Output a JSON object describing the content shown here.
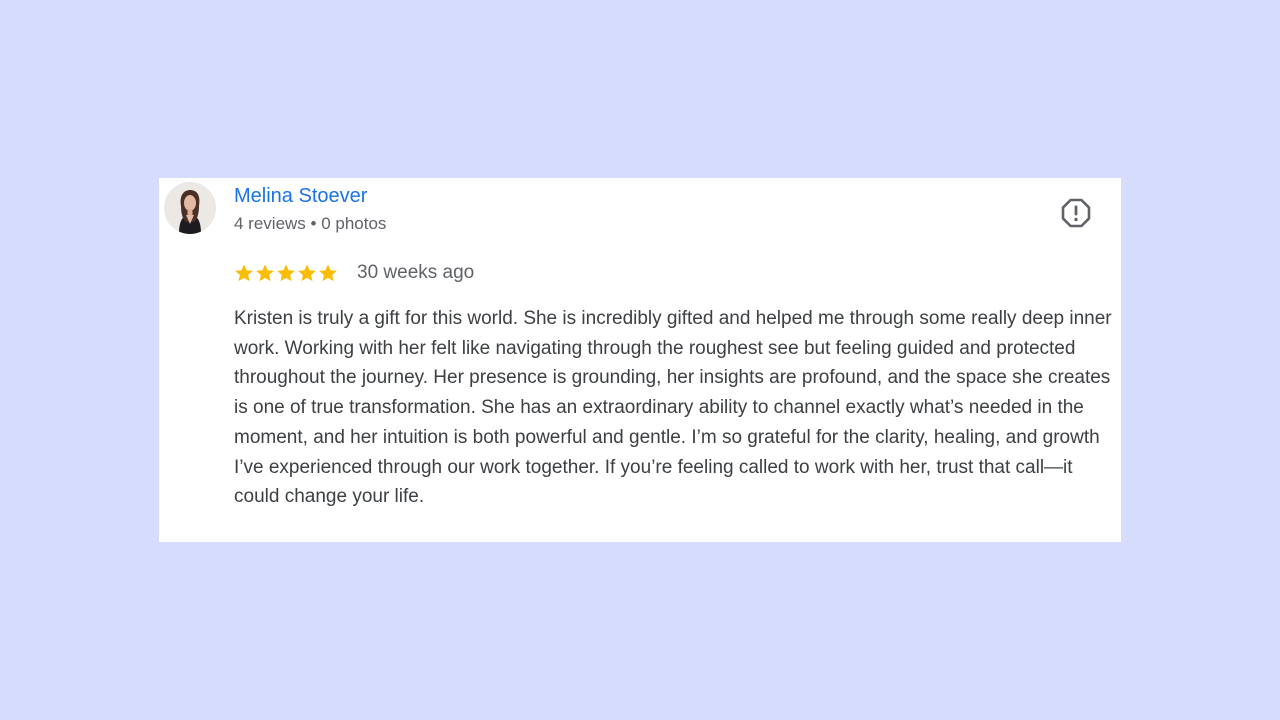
{
  "review": {
    "reviewer": {
      "name": "Melina Stoever",
      "stats": "4 reviews • 0 photos",
      "avatar_icon": "person-photo"
    },
    "rating": 5,
    "rating_max": 5,
    "time": "30 weeks ago",
    "text": "Kristen is truly a gift for this world. She is incredibly gifted and helped me through some really deep inner work. Working with her felt like navigating through the roughest see but feeling guided and protected throughout the journey. Her presence is grounding, her insights are profound, and the space she creates is one of true transformation. She has an extraordinary ability to channel exactly what’s needed in the moment, and her intuition is both powerful and gentle. I’m so grateful for the clarity, healing, and growth I’ve experienced through our work together. If you’re feeling called to work with her, trust that call—it could change your life.",
    "report_icon": "report-flag-icon"
  },
  "colors": {
    "background": "#d6dcfb",
    "card": "#ffffff",
    "name": "#1a73e8",
    "star": "#fbbc04",
    "secondary_text": "#5f6368",
    "body_text": "#3c4043"
  }
}
